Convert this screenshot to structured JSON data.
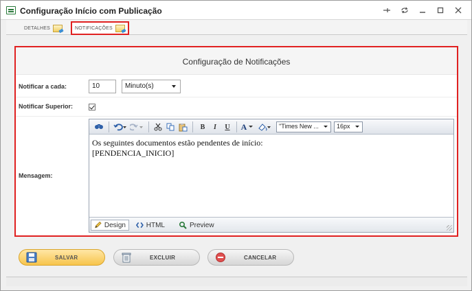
{
  "window": {
    "title": "Configuração Início com Publicação"
  },
  "tabs": [
    {
      "label": "DETALHES"
    },
    {
      "label": "NOTIFICAÇÕES"
    }
  ],
  "section": {
    "title": "Configuração de Notificações"
  },
  "form": {
    "notify_every_label": "Notificar a cada:",
    "notify_every_value": "10",
    "unit_selected": "Minuto(s)",
    "notify_superior_label": "Notificar Superior:",
    "notify_superior_checked": true,
    "message_label": "Mensagem:"
  },
  "editor": {
    "font_family": "\"Times New ...",
    "font_size": "16px",
    "bold_label": "B",
    "italic_label": "I",
    "underline_label": "U",
    "font_color_label": "A",
    "body_lines": [
      "Os seguintes documentos estão pendentes de início:",
      "[PENDENCIA_INICIO]"
    ],
    "modes": [
      {
        "label": "Design"
      },
      {
        "label": "HTML"
      },
      {
        "label": "Preview"
      }
    ]
  },
  "buttons": {
    "save": "SALVAR",
    "delete": "EXCLUIR",
    "cancel": "CANCELAR"
  },
  "colors": {
    "highlight": "#e02020",
    "save_button": "#f7c44c",
    "cancel_icon": "#e05050"
  }
}
